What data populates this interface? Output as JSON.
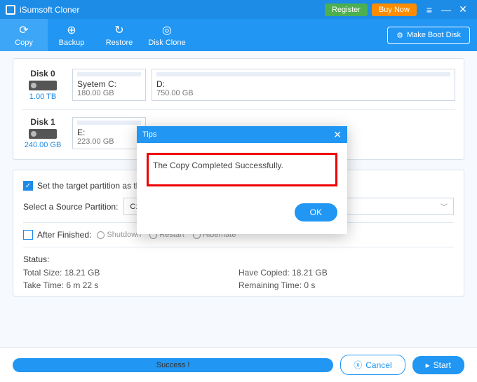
{
  "titlebar": {
    "app_name": "iSumsoft Cloner",
    "register": "Register",
    "buy_now": "Buy Now"
  },
  "tabs": {
    "copy": "Copy",
    "backup": "Backup",
    "restore": "Restore",
    "disk_clone": "Disk Clone"
  },
  "boot_disk_btn": "Make Boot Disk",
  "disks": {
    "d0": {
      "label": "Disk 0",
      "size": "1.00 TB",
      "p0_name": "Syetem C:",
      "p0_size": "180.00 GB",
      "p1_name": "D:",
      "p1_size": "750.00 GB"
    },
    "d1": {
      "label": "Disk 1",
      "size": "240.00 GB",
      "p0_name": "E:",
      "p0_size": "223.00 GB"
    }
  },
  "options": {
    "set_target_label": "Set the target partition as the b",
    "select_source_label": "Select a Source Partition:",
    "source_value": "C:",
    "after_finished_label": "After Finished:",
    "shutdown": "Shutdown",
    "restart": "Restart",
    "hibernate": "Hibernate"
  },
  "status": {
    "label": "Status:",
    "total_size": "Total Size: 18.21 GB",
    "have_copied": "Have Copied: 18.21 GB",
    "take_time": "Take Time: 6 m 22 s",
    "remaining": "Remaining Time: 0 s"
  },
  "footer": {
    "progress_text": "Success !",
    "cancel": "Cancel",
    "start": "Start"
  },
  "dialog": {
    "title": "Tips",
    "message": "The Copy Completed Successfully.",
    "ok": "OK"
  }
}
